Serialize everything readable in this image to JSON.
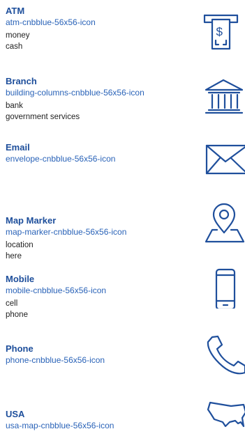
{
  "icons": [
    {
      "title": "ATM",
      "slug": "atm-cnbblue-56x56-icon",
      "keywords": [
        "money",
        "cash"
      ],
      "symbol": "$"
    },
    {
      "title": "Branch",
      "slug": "building-columns-cnbblue-56x56-icon",
      "keywords": [
        "bank",
        "government services"
      ]
    },
    {
      "title": "Email",
      "slug": "envelope-cnbblue-56x56-icon",
      "keywords": []
    },
    {
      "title": "Map Marker",
      "slug": "map-marker-cnbblue-56x56-icon",
      "keywords": [
        "location",
        "here"
      ]
    },
    {
      "title": "Mobile",
      "slug": "mobile-cnbblue-56x56-icon",
      "keywords": [
        "cell",
        "phone"
      ]
    },
    {
      "title": "Phone",
      "slug": "phone-cnbblue-56x56-icon",
      "keywords": []
    },
    {
      "title": "USA",
      "slug": "usa-map-cnbblue-56x56-icon",
      "keywords": []
    }
  ],
  "colors": {
    "title": "#1d4e9b",
    "slug": "#2a63b8",
    "keyword": "#222222",
    "icon_stroke": "#1f4f9c"
  }
}
